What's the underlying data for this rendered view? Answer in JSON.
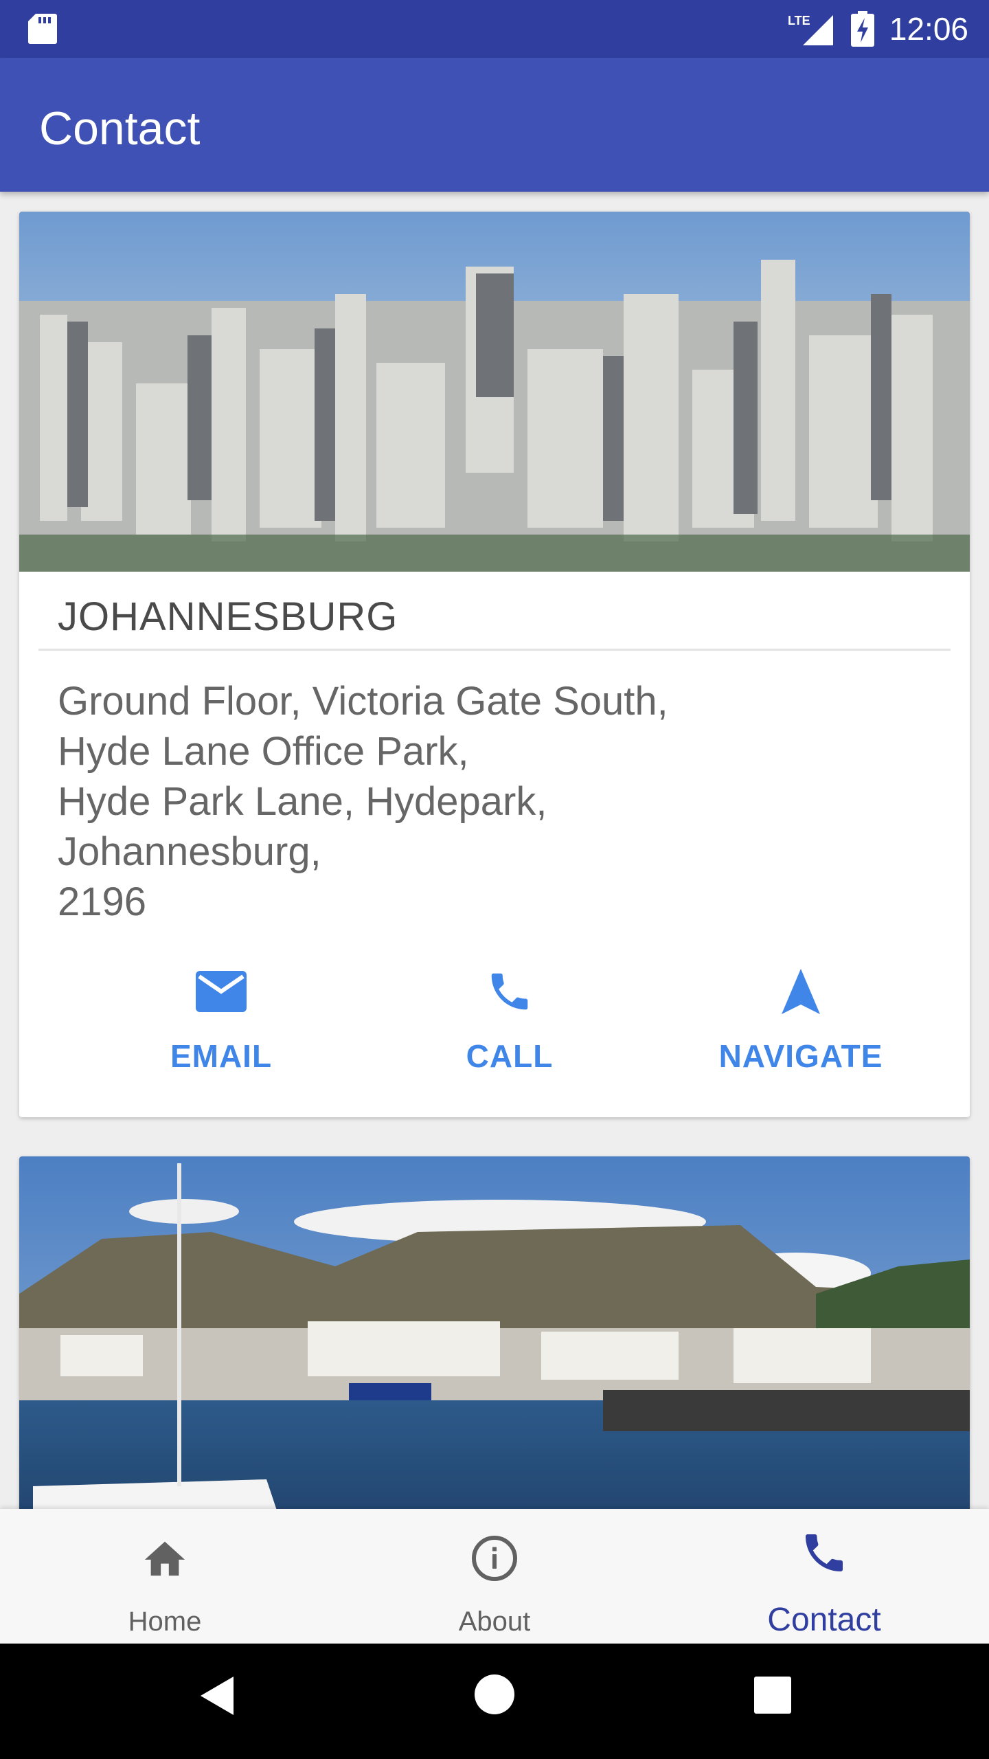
{
  "status_bar": {
    "time": "12:06",
    "network": "LTE"
  },
  "app_bar": {
    "title": "Contact"
  },
  "offices": [
    {
      "city": "JOHANNESBURG",
      "address_lines": [
        "Ground Floor, Victoria Gate South,",
        "Hyde Lane Office Park,",
        "Hyde Park Lane, Hydepark,",
        "Johannesburg,",
        "2196"
      ],
      "actions": {
        "email": "EMAIL",
        "call": "CALL",
        "navigate": "NAVIGATE"
      }
    }
  ],
  "bottom_nav": {
    "items": [
      {
        "label": "Home",
        "icon": "home-icon"
      },
      {
        "label": "About",
        "icon": "info-icon"
      },
      {
        "label": "Contact",
        "icon": "phone-icon",
        "active": true
      }
    ]
  },
  "colors": {
    "status_bar": "#303f9f",
    "app_bar": "#3f51b5",
    "action_accent": "#3f86e8",
    "nav_active": "#303f9f"
  }
}
